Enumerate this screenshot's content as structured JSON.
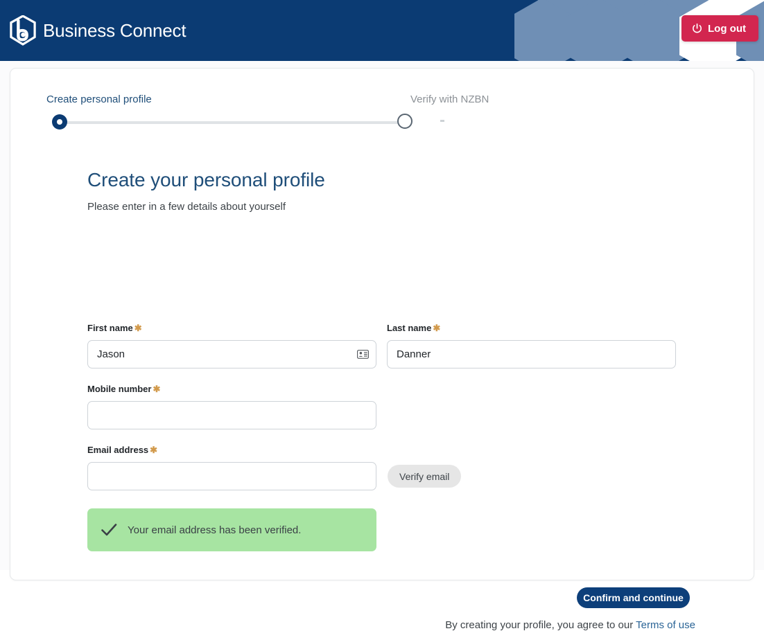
{
  "header": {
    "brand_name": "Business Connect",
    "logo_icon": "business-connect-hexagon-logo",
    "logout_label": "Log out",
    "logout_icon": "power-icon",
    "bg_color": "#0b3b73",
    "logout_color": "#d2264f",
    "hex_color": "#6f8fb5"
  },
  "stepper": {
    "steps": [
      {
        "label": "Create personal profile",
        "state": "active"
      },
      {
        "label": "Verify with NZBN",
        "state": "upcoming"
      }
    ],
    "active_color": "#0b3b73",
    "track_color": "#dfe3e6"
  },
  "main": {
    "title": "Create your personal profile",
    "subtitle": "Please enter in a few details about yourself",
    "title_color": "#1f4e79"
  },
  "form": {
    "required_marker": "✱",
    "required_color": "#d29a4c",
    "fields": [
      {
        "id": "first-name",
        "label": "First name",
        "required": true,
        "value": "Jason",
        "placeholder": "",
        "icon": "contact-card-icon"
      },
      {
        "id": "last-name",
        "label": "Last name",
        "required": true,
        "value": "Danner",
        "placeholder": ""
      },
      {
        "id": "mobile-number",
        "label": "Mobile number",
        "required": true,
        "value": "",
        "placeholder": ""
      },
      {
        "id": "email-address",
        "label": "Email address",
        "required": true,
        "value": "",
        "placeholder": ""
      }
    ],
    "verify_email_label": "Verify email",
    "success": {
      "icon": "check-icon",
      "message": "Your email address has been verified.",
      "bg_color": "#a7e4a2"
    }
  },
  "footer": {
    "confirm_label": "Confirm and continue",
    "confirm_color": "#0d3f7a",
    "terms_prefix": "By creating your profile, you agree to our ",
    "terms_link_label": "Terms of use",
    "terms_link_color": "#2a6496"
  }
}
